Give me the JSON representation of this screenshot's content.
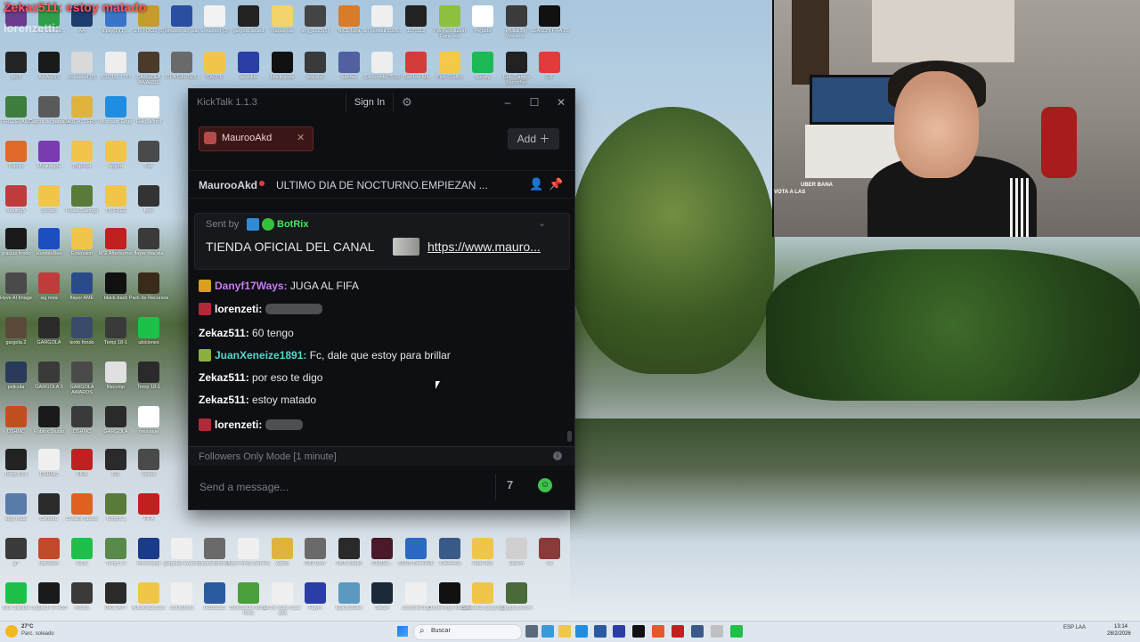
{
  "desktop": {
    "overlay_chat_line": "Zekaz511: estoy matado",
    "overlay_user2": "lorenzetti:",
    "icons": [
      {
        "label": "",
        "color": "#6a3a8c"
      },
      {
        "label": "Free Genera...",
        "color": "#2f9e4a"
      },
      {
        "label": "AA",
        "color": "#1d3b6b"
      },
      {
        "label": "lcpsy(1)(1)...",
        "color": "#3a74c9"
      },
      {
        "label": "SIN FOCO (1)",
        "color": "#c69b2e"
      },
      {
        "label": "simbolo sin pub",
        "color": "#2b4fa0"
      },
      {
        "label": "unnamed (3)",
        "color": "#f2f2f2"
      },
      {
        "label": "gargola award",
        "color": "#222222"
      },
      {
        "label": "mapas ras",
        "color": "#f3d36b"
      },
      {
        "label": "img_2025(1)",
        "color": "#444444"
      },
      {
        "label": "NICE lupa",
        "color": "#d87b2b"
      },
      {
        "label": "Sin contitul 2026...",
        "color": "#f0f0f0"
      },
      {
        "label": "1170112",
        "color": "#222222"
      },
      {
        "label": "FW Resolution Gene-est",
        "color": "#8fbf3f"
      },
      {
        "label": "Pegado",
        "color": "#ffffff"
      },
      {
        "label": "Philsa Blg Volcano...",
        "color": "#3b3b3b"
      },
      {
        "label": "SEASON FIFA 26",
        "color": "#111111"
      },
      {
        "label": "gm3",
        "color": "#242424"
      },
      {
        "label": "AWARDS",
        "color": "#1a1a1a"
      },
      {
        "label": "unnamed (2)",
        "color": "#d9d9d9"
      },
      {
        "label": "1 11 111 7777",
        "color": "#eeeeee"
      },
      {
        "label": "GARGOLA AWARDS",
        "color": "#4a3a2a"
      },
      {
        "label": "FIFA GARGOL",
        "color": "#6a6a6a"
      },
      {
        "label": "CARPE",
        "color": "#f0c64a"
      },
      {
        "label": "ae-edits",
        "color": "#2a3ea6"
      },
      {
        "label": "black-grids",
        "color": "#111111"
      },
      {
        "label": "pila.xlsx",
        "color": "#3a3a3a"
      },
      {
        "label": "banner",
        "color": "#5060a0"
      },
      {
        "label": "Sin contitul 2026",
        "color": "#eeeeee"
      },
      {
        "label": "Rss Hrs Mit",
        "color": "#d43b3b"
      },
      {
        "label": "Pico Grafico",
        "color": "#f3c947"
      },
      {
        "label": "Spotify",
        "color": "#1db954"
      },
      {
        "label": "Epic Games Launcher",
        "color": "#222222"
      },
      {
        "label": "GIF",
        "color": "#e23b3b"
      },
      {
        "label": "IRRELEVANT",
        "color": "#3d7d3d"
      },
      {
        "label": "Capcut de pantalla",
        "color": "#5a5a5a"
      },
      {
        "label": "ABCASTERS",
        "color": "#e0b43c"
      },
      {
        "label": "Microsoft Edge",
        "color": "#1f8ee0"
      },
      {
        "label": "Halo_alfred",
        "color": "#ffffff"
      },
      {
        "label": "Fulmin",
        "color": "#e06a2a"
      },
      {
        "label": "Minijuegos",
        "color": "#7a3ab0"
      },
      {
        "label": "Drip-hist",
        "color": "#f0c64a"
      },
      {
        "label": "argum",
        "color": "#f0c64a"
      },
      {
        "label": "Fab",
        "color": "#4a4a4a"
      },
      {
        "label": "heatingfr",
        "color": "#c03b3b"
      },
      {
        "label": "Locazo",
        "color": "#f0c64a"
      },
      {
        "label": "Futsal Bazinga",
        "color": "#5a7a3a"
      },
      {
        "label": "TN.FREE",
        "color": "#f0c64a"
      },
      {
        "label": "flyer",
        "color": "#333333"
      },
      {
        "label": "gracias fondo",
        "color": "#1a1a1a"
      },
      {
        "label": "HumbleBea",
        "color": "#1b4fbe"
      },
      {
        "label": "Extension",
        "color": "#f0c64a"
      },
      {
        "label": "MSI Afterburner",
        "color": "#c02020"
      },
      {
        "label": "flayer maceta",
        "color": "#3a3a3a"
      },
      {
        "label": "Hyve AI Image",
        "color": "#4a4a4a"
      },
      {
        "label": "sig mira",
        "color": "#c03b3b"
      },
      {
        "label": "flayer AME",
        "color": "#2a4a8a"
      },
      {
        "label": "black-back",
        "color": "#111111"
      },
      {
        "label": "Pack de Recursos",
        "color": "#3a2a1a"
      },
      {
        "label": "gargola 2",
        "color": "#5a4a3a"
      },
      {
        "label": "GARGOLA",
        "color": "#2a2a2a"
      },
      {
        "label": "texto fondo",
        "color": "#3a4a6a"
      },
      {
        "label": "Temp 18-1",
        "color": "#3a3a3a"
      },
      {
        "label": "ubiciones",
        "color": "#1ec04a"
      },
      {
        "label": "pelicula",
        "color": "#2a3a5a"
      },
      {
        "label": "GARGOLA 3",
        "color": "#3a3a3a"
      },
      {
        "label": "GARGOLA AWARDS",
        "color": "#4a4a4a"
      },
      {
        "label": "filecomp",
        "color": "#e0e0e0"
      },
      {
        "label": "Temp 18-1",
        "color": "#2a2a2a"
      },
      {
        "label": "DSHMC",
        "color": "#c05020"
      },
      {
        "label": "Roblox Studio",
        "color": "#1a1a1a"
      },
      {
        "label": "DSHMC",
        "color": "#3a3a3a"
      },
      {
        "label": "GARGOLA",
        "color": "#2a2a2a"
      },
      {
        "label": "message",
        "color": "#ffffff"
      },
      {
        "label": "Temp 18-1",
        "color": "#222222"
      },
      {
        "label": "DSHMC",
        "color": "#f0f0f0"
      },
      {
        "label": "FIFA",
        "color": "#c02020"
      },
      {
        "label": "GS",
        "color": "#2a2a2a"
      },
      {
        "label": "nueva",
        "color": "#4a4a4a"
      },
      {
        "label": "logo malo",
        "color": "#5a7aaa"
      },
      {
        "label": "Cerebro",
        "color": "#2a2a2a"
      },
      {
        "label": "Creator Studio",
        "color": "#e06020"
      },
      {
        "label": "Temp 5 1",
        "color": "#5a7a3a"
      },
      {
        "label": "FIFA",
        "color": "#c02020"
      },
      {
        "label": "g?",
        "color": "#3a3a3a"
      },
      {
        "label": "blackbox",
        "color": "#c04a2a"
      },
      {
        "label": "KICK",
        "color": "#1ec04a"
      },
      {
        "label": "Temp 1 4",
        "color": "#5a8a4a"
      },
      {
        "label": "entrevistas",
        "color": "#1a3a8a"
      },
      {
        "label": "gargolas awards",
        "color": "#f0f0f0"
      },
      {
        "label": "depositphotos",
        "color": "#6a6a6a"
      },
      {
        "label": "flayer meta camera",
        "color": "#f0f0f0"
      },
      {
        "label": "wandr",
        "color": "#e0b43c"
      },
      {
        "label": "IMG 0447",
        "color": "#6a6a6a"
      },
      {
        "label": "OBS Studio",
        "color": "#2a2a2a"
      },
      {
        "label": "C1d1bn...",
        "color": "#4a1a2a"
      },
      {
        "label": "ASUS DriveHub",
        "color": "#2a6ac0"
      },
      {
        "label": "73e4446a",
        "color": "#3a5a8a"
      },
      {
        "label": "Halo Hub",
        "color": "#f0c64a"
      },
      {
        "label": "lalocm",
        "color": "#d0d0d0"
      },
      {
        "label": "cel",
        "color": "#8a3a3a"
      },
      {
        "label": "Kick Symbol",
        "color": "#1ec04a"
      },
      {
        "label": "Logitech G HUB",
        "color": "#1a1a1a"
      },
      {
        "label": "micros",
        "color": "#3a3a3a"
      },
      {
        "label": "IMG 2477",
        "color": "#2a2a2a"
      },
      {
        "label": "Automatizacion",
        "color": "#f0c64a"
      },
      {
        "label": "stockphoto",
        "color": "#f0f0f0"
      },
      {
        "label": "bcb2a2a5",
        "color": "#2a5aa0"
      },
      {
        "label": "BlueStacks Multi-Insta",
        "color": "#4aa03a"
      },
      {
        "label": "al the stars mate add",
        "color": "#f0f0f0"
      },
      {
        "label": "Flayer",
        "color": "#2a3ea6"
      },
      {
        "label": "EpicInstaller",
        "color": "#5a9ac0"
      },
      {
        "label": "Steam",
        "color": "#1b2838"
      },
      {
        "label": "unnamed (1)",
        "color": "#f0f0f0"
      },
      {
        "label": "CurseForge Installer",
        "color": "#111111"
      },
      {
        "label": "camisetas gargolas",
        "color": "#f0c64a"
      },
      {
        "label": "gargola primer",
        "color": "#4a6a3a"
      }
    ]
  },
  "kicktalk": {
    "title": "KickTalk 1.1.3",
    "sign_in": "Sign In",
    "settings_icon": "gear-icon",
    "tab_label": "MaurooAkd",
    "add_label": "Add",
    "pinned": {
      "user": "MaurooAkd",
      "text": "ULTIMO DIA DE NOCTURNO.EMPIEZAN ..."
    },
    "bot_message": {
      "sent_by": "Sent by",
      "bot_name": "BotRix",
      "text": "TIENDA OFICIAL DEL CANAL",
      "link": "https://www.mauro..."
    },
    "messages": [
      {
        "user": "Danyf17Ways:",
        "text": "JUGA AL FIFA",
        "color": "#c67cf0",
        "badge": "#d8a020",
        "emote": false
      },
      {
        "user": "lorenzeti:",
        "text": "",
        "color": "#ffffff",
        "badge": "#b02a3a",
        "emote": true,
        "emote_width": 64
      },
      {
        "user": "Zekaz511:",
        "text": "60 tengo",
        "color": "#ffffff",
        "badge": "",
        "emote": false
      },
      {
        "user": "JuanXeneize1891:",
        "text": "Fc, dale que estoy para brillar",
        "color": "#57d6c8",
        "badge": "#8ab040",
        "emote": false
      },
      {
        "user": "Zekaz511:",
        "text": "por eso te digo",
        "color": "#ffffff",
        "badge": "",
        "emote": false
      },
      {
        "user": "Zekaz511:",
        "text": "estoy matado",
        "color": "#ffffff",
        "badge": "",
        "emote": false
      },
      {
        "user": "lorenzeti:",
        "text": "",
        "color": "#ffffff",
        "badge": "#b02a3a",
        "emote": true,
        "emote_width": 42
      }
    ],
    "mode": "Followers Only Mode [1 minute]",
    "input_placeholder": "Send a message..."
  },
  "webcam": {
    "overlay_lines": [
      "UBER BANA",
      "VOTA A LAS"
    ]
  },
  "taskbar": {
    "weather_temp": "27°C",
    "weather_desc": "Parc. soleado",
    "search_label": "Buscar",
    "lang": "ESP LAA",
    "time": "13:14",
    "date": "28/2/2026"
  }
}
